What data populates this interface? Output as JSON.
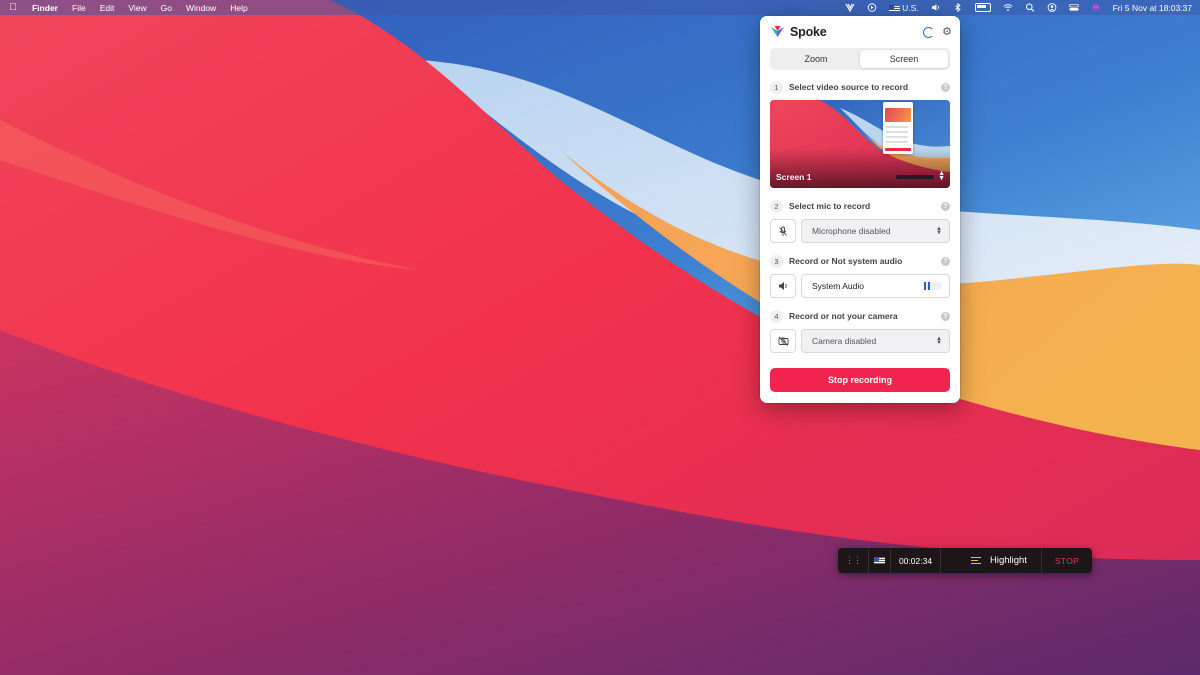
{
  "menubar": {
    "app_name": "Finder",
    "menus": [
      "File",
      "Edit",
      "View",
      "Go",
      "Window",
      "Help"
    ],
    "input_source": "U.S.",
    "datetime": "Fri 5 Nov at  18:03:37",
    "icons": [
      "spoke-icon",
      "play-icon",
      "flag-icon",
      "volume-icon",
      "bluetooth-icon",
      "battery-icon",
      "wifi-icon",
      "search-icon",
      "user-icon",
      "control-center-icon",
      "siri-icon"
    ]
  },
  "panel": {
    "brand": "Spoke",
    "tabs": [
      {
        "label": "Zoom",
        "active": false
      },
      {
        "label": "Screen",
        "active": true
      }
    ],
    "steps": [
      {
        "num": "1",
        "label": "Select video source to record"
      },
      {
        "num": "2",
        "label": "Select mic to record"
      },
      {
        "num": "3",
        "label": "Record or Not system audio"
      },
      {
        "num": "4",
        "label": "Record or not your camera"
      }
    ],
    "help_glyph": "?",
    "source_preview_label": "Screen 1",
    "mic_select": "Microphone disabled",
    "system_audio": "System Audio",
    "camera_select": "Camera disabled",
    "stop_button": "Stop recording",
    "accent_color": "#f0244f"
  },
  "recbar": {
    "timer": "00:02:34",
    "highlight_label": "Highlight",
    "stop_label": "STOP"
  }
}
